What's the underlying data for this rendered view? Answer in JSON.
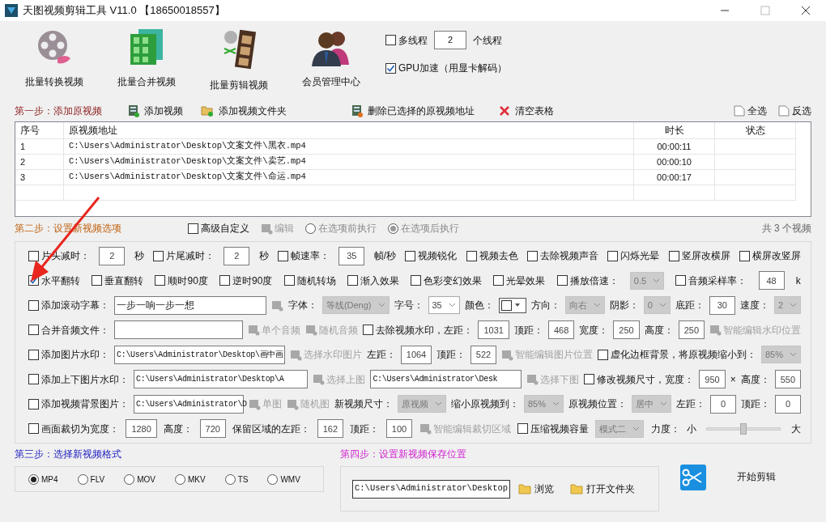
{
  "window": {
    "title": "天图视频剪辑工具 V11.0 【18650018557】"
  },
  "toolbar": [
    {
      "label": "批量转换视频"
    },
    {
      "label": "批量合并视频"
    },
    {
      "label": "批量剪辑视频"
    },
    {
      "label": "会员管理中心"
    }
  ],
  "threads": {
    "label": "多线程",
    "checked": false,
    "value": "2",
    "suffix": "个线程"
  },
  "gpu": {
    "label": "GPU加速（用显卡解码）",
    "checked": true
  },
  "step1": {
    "title": "第一步：添加原视频",
    "actions": [
      {
        "label": "添加视频"
      },
      {
        "label": "添加视频文件夹"
      },
      {
        "label": "删除已选择的原视频地址"
      },
      {
        "label": "清空表格"
      }
    ],
    "select_all": "全选",
    "invert": "反选"
  },
  "table": {
    "columns": [
      "序号",
      "原视频地址",
      "时长",
      "状态"
    ],
    "rows": [
      {
        "cells": [
          "1",
          "C:\\Users\\Administrator\\Desktop\\文案文件\\黑衣.mp4",
          "00:00:11"
        ]
      },
      {
        "cells": [
          "2",
          "C:\\Users\\Administrator\\Desktop\\文案文件\\卖艺.mp4",
          "00:00:10"
        ]
      },
      {
        "cells": [
          "3",
          "C:\\Users\\Administrator\\Desktop\\文案文件\\命运.mp4",
          "00:00:17"
        ]
      }
    ]
  },
  "step2": {
    "title": "第二步：设置新视频选项",
    "advanced": {
      "label": "高级自定义",
      "checked": false
    },
    "edit": "编辑",
    "radios": [
      {
        "label": "在选项前执行",
        "selected": false
      },
      {
        "label": "在选项后执行",
        "selected": true
      }
    ],
    "count": "共 3 个视频"
  },
  "option_rows": [
    {
      "items": [
        {
          "kind": "check",
          "label": "片头减时：",
          "checked": false
        },
        {
          "kind": "input",
          "value": "2"
        },
        {
          "kind": "text",
          "label": "秒"
        },
        {
          "kind": "check",
          "label": "片尾减时：",
          "checked": false
        },
        {
          "kind": "input",
          "value": "2"
        },
        {
          "kind": "text",
          "label": "秒"
        },
        {
          "kind": "check",
          "label": "帧速率：",
          "checked": false
        },
        {
          "kind": "input",
          "value": "35"
        },
        {
          "kind": "text",
          "label": "帧/秒"
        },
        {
          "kind": "check",
          "label": "视频锐化",
          "checked": false
        },
        {
          "kind": "check",
          "label": "视频去色",
          "checked": false
        },
        {
          "kind": "check",
          "label": "去除视频声音",
          "checked": false
        },
        {
          "kind": "check",
          "label": "闪烁光晕",
          "checked": false
        },
        {
          "kind": "check",
          "label": "竖屏改横屏",
          "checked": false
        },
        {
          "kind": "check",
          "label": "横屏改竖屏",
          "checked": false
        }
      ]
    },
    {
      "items": [
        {
          "kind": "check",
          "label": "水平翻转",
          "checked": true
        },
        {
          "kind": "check",
          "label": "垂直翻转",
          "checked": false
        },
        {
          "kind": "check",
          "label": "顺时90度",
          "checked": false
        },
        {
          "kind": "check",
          "label": "逆时90度",
          "checked": false
        },
        {
          "kind": "check",
          "label": "随机转场",
          "checked": false
        },
        {
          "kind": "check",
          "label": "渐入效果",
          "checked": false
        },
        {
          "kind": "check",
          "label": "色彩变幻效果",
          "checked": false
        },
        {
          "kind": "check",
          "label": "光晕效果",
          "checked": false
        },
        {
          "kind": "check",
          "label": "播放倍速：",
          "checked": false
        },
        {
          "kind": "select",
          "value": "0.5",
          "disabled": true
        },
        {
          "kind": "check",
          "label": "音频采样率：",
          "checked": false
        },
        {
          "kind": "input",
          "value": "48"
        },
        {
          "kind": "text",
          "label": "k"
        }
      ]
    },
    {
      "items": [
        {
          "kind": "check",
          "label": "添加滚动字幕：",
          "checked": false
        },
        {
          "kind": "field",
          "value": "一步一响一步一想"
        },
        {
          "kind": "tool"
        },
        {
          "kind": "text",
          "label": "字体："
        },
        {
          "kind": "select",
          "value": "等线(Deng)",
          "disabled": true
        },
        {
          "kind": "text",
          "label": "字号："
        },
        {
          "kind": "select",
          "value": "35",
          "disabled": false
        },
        {
          "kind": "text",
          "label": "颜色："
        },
        {
          "kind": "color"
        },
        {
          "kind": "text",
          "label": "方向："
        },
        {
          "kind": "select",
          "value": "向右",
          "disabled": true
        },
        {
          "kind": "text",
          "label": "阴影："
        },
        {
          "kind": "select",
          "value": "0",
          "disabled": true
        },
        {
          "kind": "text",
          "label": "底距："
        },
        {
          "kind": "input",
          "value": "30"
        },
        {
          "kind": "text",
          "label": "速度："
        },
        {
          "kind": "select",
          "value": "2",
          "disabled": true
        }
      ]
    },
    {
      "items": [
        {
          "kind": "check",
          "label": "合并音频文件：",
          "checked": false
        },
        {
          "kind": "field"
        },
        {
          "kind": "tool",
          "label": "单个音频"
        },
        {
          "kind": "tool",
          "label": "随机音频"
        },
        {
          "kind": "check",
          "label": "去除视频水印，左距：",
          "checked": false
        },
        {
          "kind": "input",
          "value": "1031"
        },
        {
          "kind": "text",
          "label": "顶距："
        },
        {
          "kind": "input",
          "value": "468"
        },
        {
          "kind": "text",
          "label": "宽度："
        },
        {
          "kind": "input",
          "value": "250"
        },
        {
          "kind": "text",
          "label": "高度："
        },
        {
          "kind": "input",
          "value": "250"
        },
        {
          "kind": "tool",
          "label": "智能编辑水印位置"
        }
      ]
    },
    {
      "items": [
        {
          "kind": "check",
          "label": "添加图片水印：",
          "checked": false
        },
        {
          "kind": "field",
          "value": "C:\\Users\\Administrator\\Desktop\\画中画"
        },
        {
          "kind": "tool",
          "label": "选择水印图片"
        },
        {
          "kind": "text",
          "label": "左距："
        },
        {
          "kind": "input",
          "value": "1064"
        },
        {
          "kind": "text",
          "label": "顶距："
        },
        {
          "kind": "input",
          "value": "522"
        },
        {
          "kind": "tool",
          "label": "智能编辑图片位置"
        },
        {
          "kind": "check",
          "label": "虚化边框背景，将原视频缩小到：",
          "checked": false
        },
        {
          "kind": "select",
          "value": "85%",
          "disabled": true
        }
      ]
    },
    {
      "items": [
        {
          "kind": "check",
          "label": "添加上下图片水印：",
          "checked": false
        },
        {
          "kind": "field",
          "value": "C:\\Users\\Administrator\\Desktop\\A"
        },
        {
          "kind": "tool",
          "label": "选择上图"
        },
        {
          "kind": "field",
          "value": "C:\\Users\\Administrator\\Desk"
        },
        {
          "kind": "tool",
          "label": "选择下图"
        },
        {
          "kind": "check",
          "label": "修改视频尺寸，宽度：",
          "checked": false
        },
        {
          "kind": "input",
          "value": "950"
        },
        {
          "kind": "text",
          "label": "×"
        },
        {
          "kind": "text",
          "label": "高度："
        },
        {
          "kind": "input",
          "value": "550"
        }
      ]
    },
    {
      "items": [
        {
          "kind": "check",
          "label": "添加视频背景图片：",
          "checked": false
        },
        {
          "kind": "field",
          "value": "C:\\Users\\Administrator\\D"
        },
        {
          "kind": "tool",
          "label": "单图"
        },
        {
          "kind": "tool",
          "label": "随机图"
        },
        {
          "kind": "text",
          "label": "新视频尺寸："
        },
        {
          "kind": "select",
          "value": "原视频",
          "disabled": true
        },
        {
          "kind": "text",
          "label": "缩小原视频到："
        },
        {
          "kind": "select",
          "value": "85%",
          "disabled": true
        },
        {
          "kind": "text",
          "label": "原视频位置："
        },
        {
          "kind": "select",
          "value": "居中",
          "disabled": true
        },
        {
          "kind": "text",
          "label": "左距："
        },
        {
          "kind": "input",
          "value": "0"
        },
        {
          "kind": "text",
          "label": "顶距："
        },
        {
          "kind": "input",
          "value": "0"
        }
      ]
    },
    {
      "items": [
        {
          "kind": "check",
          "label": "画面裁切为宽度：",
          "checked": false
        },
        {
          "kind": "input",
          "value": "1280"
        },
        {
          "kind": "text",
          "label": "高度："
        },
        {
          "kind": "input",
          "value": "720"
        },
        {
          "kind": "text",
          "label": "保留区域的左距："
        },
        {
          "kind": "input",
          "value": "162"
        },
        {
          "kind": "text",
          "label": "顶距："
        },
        {
          "kind": "input",
          "value": "100"
        },
        {
          "kind": "tool",
          "label": "智能编辑裁切区域"
        },
        {
          "kind": "check",
          "label": "压缩视频容量",
          "checked": false
        },
        {
          "kind": "select",
          "value": "模式二",
          "disabled": true
        },
        {
          "kind": "text",
          "label": "力度："
        },
        {
          "kind": "text",
          "label": "小"
        },
        {
          "kind": "slider",
          "level": 0.5
        },
        {
          "kind": "text",
          "label": "大"
        }
      ]
    }
  ],
  "step3": {
    "title": "第三步：选择新视频格式",
    "formats": [
      {
        "label": "MP4",
        "selected": true
      },
      {
        "label": "FLV",
        "selected": false
      },
      {
        "label": "MOV",
        "selected": false
      },
      {
        "label": "MKV",
        "selected": false
      },
      {
        "label": "TS",
        "selected": false
      },
      {
        "label": "WMV",
        "selected": false
      }
    ]
  },
  "step4": {
    "title": "第四步：设置新视频保存位置",
    "path": "C:\\Users\\Administrator\\Desktop",
    "browse": "浏览",
    "open_folder": "打开文件夹",
    "start": "开始剪辑"
  }
}
